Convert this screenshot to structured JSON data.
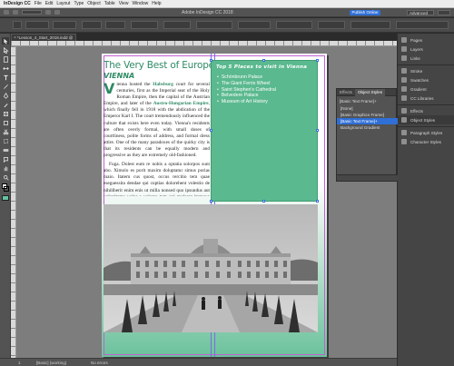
{
  "app": {
    "name": "InDesign CC",
    "menus": [
      "File",
      "Edit",
      "Layout",
      "Type",
      "Object",
      "Table",
      "View",
      "Window",
      "Help"
    ],
    "window_title": "Adobe InDesign CC 2018",
    "publish_label": "Publish Online",
    "workspace": "Advanced"
  },
  "document": {
    "tab_label": "*Lesson_4_Start_2018.indd @ 67%"
  },
  "page": {
    "headline": "The Very Best of Europe",
    "subhead": "VIENNA",
    "dropcap": "V",
    "para1_a": "ienna hosted the ",
    "para1_hl1": "Habsburg",
    "para1_b": " court for several centuries, first as the Imperial seat of the Holy Roman Empire, then the capital of the Austrian Empire, and later of the ",
    "para1_hl2": "Austro-Hungarian Empire",
    "para1_c": ", which finally fell in 1918 with the abdication of the Emperor Karl I. The court tremendously influenced the culture that exists here even today. Vienna's residents are often overly formal, with small doses of courtliness, polite forms of address, and formal dress attire. One of the many paradoxes of the quirky city is that its residents can be equally modern and progressive as they are extremely old-fashioned.",
    "para2": "Fuga. Dolest eum re nobis a optatia solorpos sunt abo. Ximolo es porit maxim doluptatur simus porias maio. Itatem cus quost, occus rercitio tem quae eseguessita dendae qui cuptias dolorehent volestio de nihiliberit enim enis ut milla nonsed quo ipsundus aut volupitame volor a volorro tem qui molorer itemque delis sunto."
  },
  "sidebar": {
    "heading": "Top 5 Places to visit in Vienna",
    "items": [
      "Schönbrunn Palace",
      "The Giant Ferris Wheel",
      "Saint Stephen's Cathedral",
      "Belvedere Palace",
      "Museum of Art History"
    ]
  },
  "statusbar": {
    "page_number": "1",
    "master": "[Basic] (working)",
    "errors": "No errors"
  },
  "panels": {
    "dock": [
      {
        "label": "Pages",
        "icon": "pages-icon"
      },
      {
        "label": "Layers",
        "icon": "layers-icon"
      },
      {
        "label": "Links",
        "icon": "links-icon"
      },
      {
        "label": "Stroke",
        "icon": "stroke-icon"
      },
      {
        "label": "Swatches",
        "icon": "swatches-icon"
      },
      {
        "label": "Gradient",
        "icon": "gradient-icon"
      },
      {
        "label": "CC Libraries",
        "icon": "cc-libraries-icon"
      },
      {
        "label": "Effects",
        "icon": "effects-icon"
      },
      {
        "label": "Object Styles",
        "icon": "object-styles-icon"
      },
      {
        "label": "Paragraph Styles",
        "icon": "paragraph-styles-icon"
      },
      {
        "label": "Character Styles",
        "icon": "character-styles-icon"
      }
    ],
    "object_styles": {
      "tabs": [
        "Effects",
        "Object Styles"
      ],
      "current": "[Basic Text Frame]+",
      "items": [
        "[None]",
        "[Basic Graphics Frame]",
        "[Basic Text Frame]+",
        "Background Gradient"
      ],
      "selected_index": 2
    }
  },
  "colors": {
    "accent_green": "#2e8a64",
    "sidebar_green": "#5bb98f",
    "selection_blue": "#2f6fd6"
  }
}
